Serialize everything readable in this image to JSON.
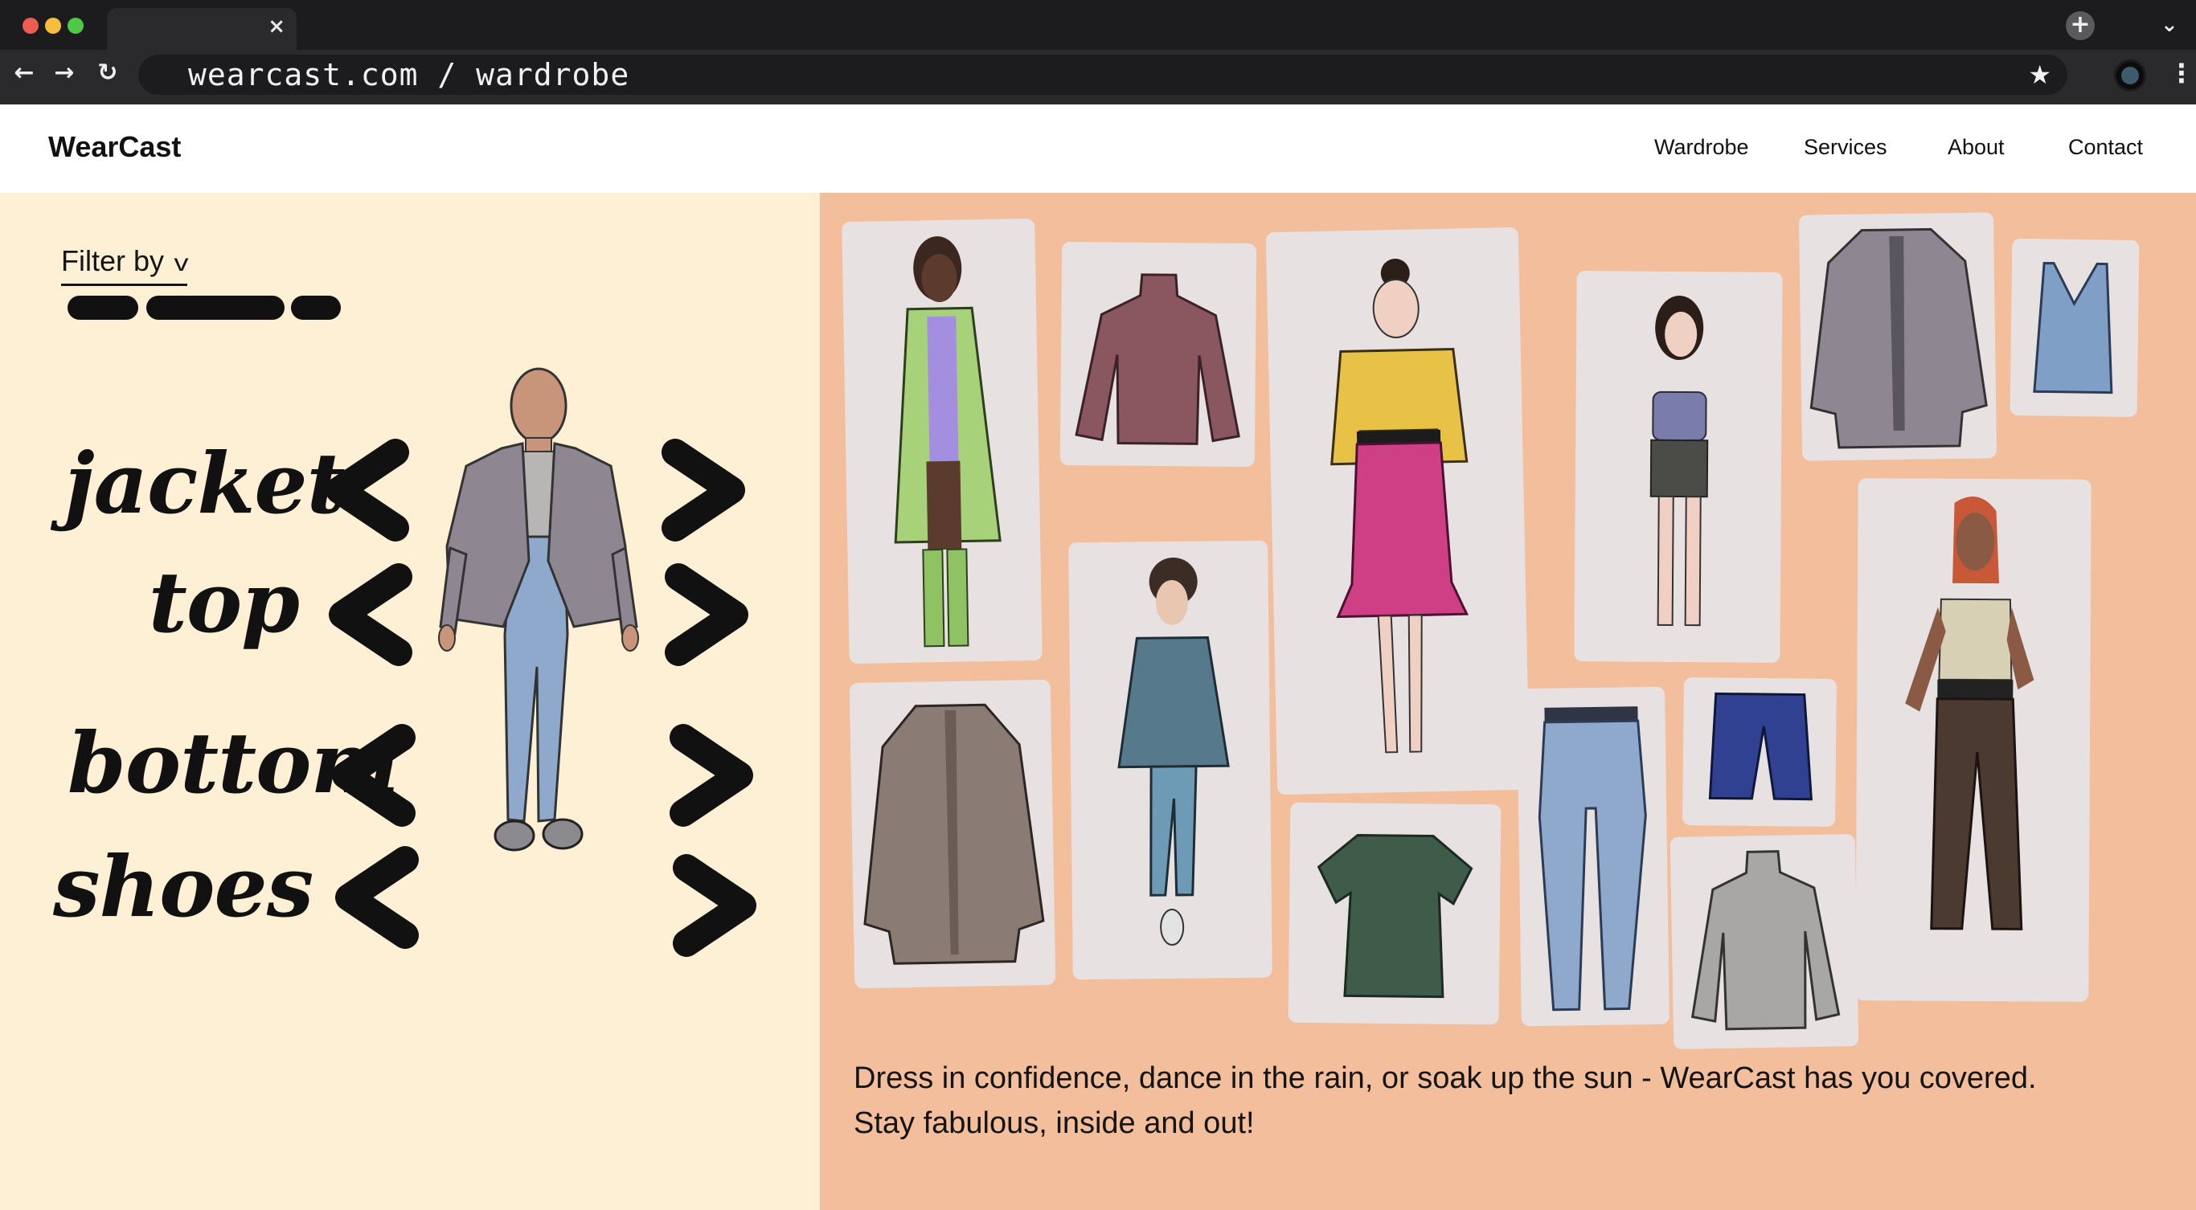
{
  "browser": {
    "url": "wearcast.com / wardrobe",
    "tab_close": "×",
    "new_tab": "+",
    "tab_menu": "⌄",
    "back": "←",
    "forward": "→",
    "reload": "↻",
    "bookmark": "★",
    "menu": "⋮"
  },
  "site": {
    "logo": "WearCast",
    "nav": [
      "Wardrobe",
      "Services",
      "About",
      "Contact"
    ]
  },
  "left_panel": {
    "filter_label": "Filter by",
    "filter_chevron": "v",
    "categories": [
      "jacket",
      "top",
      "bottom",
      "shoes"
    ]
  },
  "right_panel": {
    "tagline_line1": "Dress in confidence, dance in the rain, or soak up the sun - WearCast has you covered.",
    "tagline_line2": "Stay fabulous, inside and out!"
  },
  "colors": {
    "left_bg": "#fdf0d4",
    "right_bg": "#f3be9c",
    "card_bg": "#e8e1e2",
    "chrome_bg": "#2a2a2c"
  }
}
